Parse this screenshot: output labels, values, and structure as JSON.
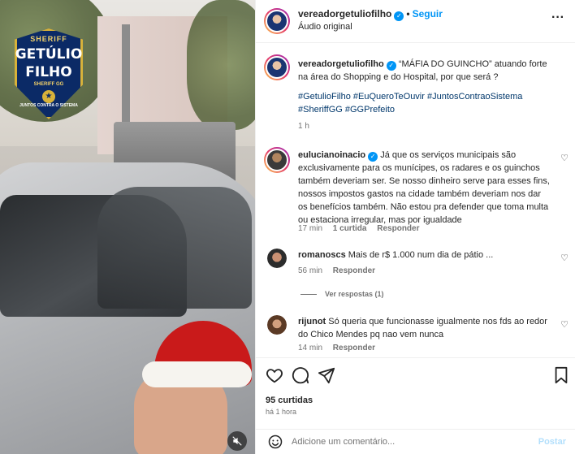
{
  "media": {
    "badge": {
      "top": "SHERIFF",
      "line1": "GETÚLIO",
      "line2": "FILHO",
      "sub": "SHERIFF GG",
      "tag": "JUNTOS CONTRA O SISTEMA"
    },
    "mute_icon": "speaker-muted-icon"
  },
  "header": {
    "username": "vereadorgetuliofilho",
    "follow_label": "Seguir",
    "audio": "Áudio original",
    "more_icon": "more-horizontal-icon"
  },
  "caption": {
    "username": "vereadorgetuliofilho",
    "text": "“MÁFIA DO GUINCHO” atuando forte na área do Shopping e do Hospital, por que será ?",
    "hashtags": "#GetulioFilho #EuQueroTeOuvir #JuntosContraoSistema #SheriffGG #GGPrefeito",
    "time": "1 h"
  },
  "comments": [
    {
      "username": "eulucianoinacio",
      "verified": true,
      "text": "Já que os serviços municipais são exclusivamente para os munícipes, os radares e os guinchos também deveriam ser. Se nosso dinheiro serve para esses fins, nossos impostos gastos na cidade também deveriam nos dar os benefícios também. Não estou pra defender que toma multa ou estaciona irregular, mas por igualdade",
      "time": "17 min",
      "likes": "1 curtida",
      "reply": "Responder"
    },
    {
      "username": "romanoscs",
      "verified": false,
      "text": "Mais de r$ 1.000 num dia de pátio ...",
      "time": "56 min",
      "reply": "Responder",
      "view_replies": "Ver respostas (1)"
    },
    {
      "username": "rijunot",
      "verified": false,
      "text": "Só queria que funcionasse igualmente nos fds ao redor do Chico Mendes pq nao vem nunca",
      "time": "14 min",
      "reply": "Responder"
    }
  ],
  "actions": {
    "like_icon": "heart-icon",
    "comment_icon": "comment-icon",
    "share_icon": "send-icon",
    "save_icon": "bookmark-icon",
    "likes": "95 curtidas",
    "time": "há 1 hora"
  },
  "composer": {
    "placeholder": "Adicione um comentário...",
    "post_label": "Postar",
    "emoji_icon": "emoji-icon"
  },
  "colors": {
    "accent": "#0095f6",
    "link": "#00376b",
    "muted": "#737373"
  }
}
